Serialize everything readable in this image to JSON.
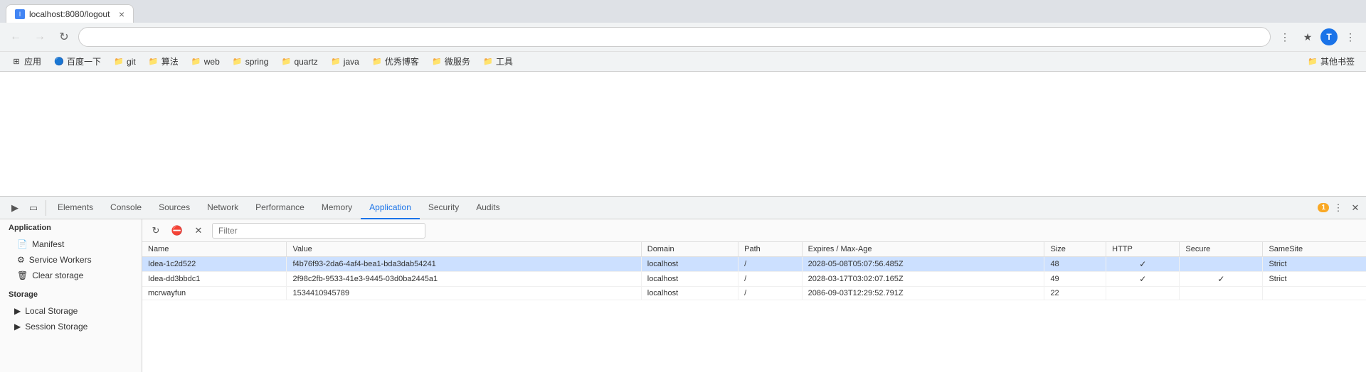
{
  "browser": {
    "address": "localhost:8080/logout",
    "tab_title": "localhost:8080/logout"
  },
  "bookmarks": {
    "items": [
      {
        "id": "apps",
        "label": "应用",
        "icon": "⊞"
      },
      {
        "id": "baidu",
        "label": "百度一下",
        "icon": "🔵"
      },
      {
        "id": "git",
        "label": "git",
        "icon": "📁"
      },
      {
        "id": "suanfa",
        "label": "算法",
        "icon": "📁"
      },
      {
        "id": "web",
        "label": "web",
        "icon": "📁"
      },
      {
        "id": "spring",
        "label": "spring",
        "icon": "📁"
      },
      {
        "id": "quartz",
        "label": "quartz",
        "icon": "📁"
      },
      {
        "id": "java",
        "label": "java",
        "icon": "📁"
      },
      {
        "id": "youxiuboke",
        "label": "优秀博客",
        "icon": "📁"
      },
      {
        "id": "weifuwu",
        "label": "微服务",
        "icon": "📁"
      },
      {
        "id": "gongju",
        "label": "工具",
        "icon": "📁"
      }
    ],
    "other": "其他书签"
  },
  "devtools": {
    "tabs": [
      {
        "id": "elements",
        "label": "Elements"
      },
      {
        "id": "console",
        "label": "Console"
      },
      {
        "id": "sources",
        "label": "Sources"
      },
      {
        "id": "network",
        "label": "Network"
      },
      {
        "id": "performance",
        "label": "Performance"
      },
      {
        "id": "memory",
        "label": "Memory"
      },
      {
        "id": "application",
        "label": "Application",
        "active": true
      },
      {
        "id": "security",
        "label": "Security"
      },
      {
        "id": "audits",
        "label": "Audits"
      }
    ],
    "warning_count": "1",
    "sidebar": {
      "app_section": "Application",
      "items": [
        {
          "id": "manifest",
          "label": "Manifest",
          "icon": "📄"
        },
        {
          "id": "service-workers",
          "label": "Service Workers",
          "icon": "⚙"
        },
        {
          "id": "clear-storage",
          "label": "Clear storage",
          "icon": "🗑"
        }
      ],
      "storage_section": "Storage",
      "storage_items": [
        {
          "id": "local-storage",
          "label": "Local Storage",
          "icon": "▶",
          "expanded": false
        },
        {
          "id": "session-storage",
          "label": "Session Storage",
          "icon": "▶",
          "expanded": false
        }
      ]
    },
    "cookie_table": {
      "columns": [
        "Name",
        "Value",
        "Domain",
        "Path",
        "Expires / Max-Age",
        "Size",
        "HTTP",
        "Secure",
        "SameSite"
      ],
      "rows": [
        {
          "name": "Idea-1c2d522",
          "value": "f4b76f93-2da6-4af4-bea1-bda3dab54241",
          "domain": "localhost",
          "path": "/",
          "expires": "2028-05-08T05:07:56.485Z",
          "size": "48",
          "http": "✓",
          "secure": "",
          "samesite": "Strict"
        },
        {
          "name": "Idea-dd3bbdc1",
          "value": "2f98c2fb-9533-41e3-9445-03d0ba2445a1",
          "domain": "localhost",
          "path": "/",
          "expires": "2028-03-17T03:02:07.165Z",
          "size": "49",
          "http": "✓",
          "secure": "✓",
          "samesite": "Strict"
        },
        {
          "name": "mcrwayfun",
          "value": "1534410945789",
          "domain": "localhost",
          "path": "/",
          "expires": "2086-09-03T12:29:52.791Z",
          "size": "22",
          "http": "",
          "secure": "",
          "samesite": ""
        }
      ]
    },
    "filter_placeholder": "Filter"
  }
}
